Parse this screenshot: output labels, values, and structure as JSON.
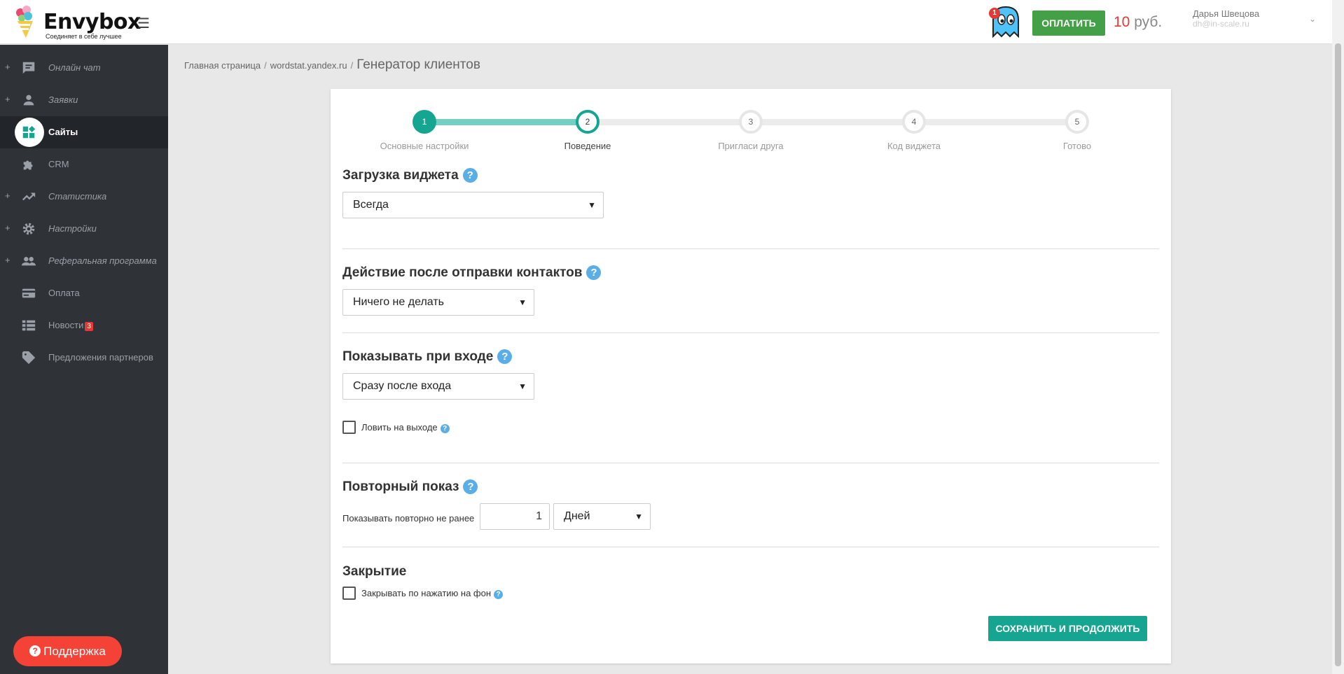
{
  "header": {
    "logo_text": "Envybox",
    "logo_tagline": "Соединяет в себе лучшее",
    "notification_count": "1",
    "pay_label": "ОПЛАТИТЬ",
    "balance_amount": "10",
    "balance_currency": " руб.",
    "user_name": "Дарья Швецова",
    "user_email": "dh@in-scale.ru"
  },
  "sidebar": {
    "items": [
      {
        "label": "Онлайн чат",
        "icon": "chat-icon"
      },
      {
        "label": "Заявки",
        "icon": "person-icon"
      },
      {
        "label": "Сайты",
        "icon": "widgets-icon"
      },
      {
        "label": "CRM",
        "icon": "puzzle-icon"
      },
      {
        "label": "Статистика",
        "icon": "trending-icon"
      },
      {
        "label": "Настройки",
        "icon": "gear-icon"
      },
      {
        "label": "Реферальная программа",
        "icon": "people-icon"
      },
      {
        "label": "Оплата",
        "icon": "card-icon"
      },
      {
        "label": "Новости",
        "icon": "list-icon",
        "badge": "3"
      },
      {
        "label": "Предложения партнеров",
        "icon": "tag-icon"
      }
    ],
    "support_label": "Поддержка"
  },
  "breadcrumb": {
    "home": "Главная страница",
    "site": "wordstat.yandex.ru",
    "current": "Генератор клиентов"
  },
  "stepper": {
    "steps": [
      {
        "num": "1",
        "label": "Основные настройки"
      },
      {
        "num": "2",
        "label": "Поведение"
      },
      {
        "num": "3",
        "label": "Пригласи друга"
      },
      {
        "num": "4",
        "label": "Код виджета"
      },
      {
        "num": "5",
        "label": "Готово"
      }
    ],
    "current_step": 2
  },
  "sections": {
    "load": {
      "title": "Загрузка виджета",
      "value": "Всегда"
    },
    "after_submit": {
      "title": "Действие после отправки контактов",
      "value": "Ничего не делать"
    },
    "show_on_enter": {
      "title": "Показывать при входе",
      "value": "Сразу после входа",
      "exit_label": "Ловить на выходе"
    },
    "repeat": {
      "title": "Повторный показ",
      "label": "Показывать повторно не ранее",
      "number": "1",
      "unit": "Дней"
    },
    "close": {
      "title": "Закрытие",
      "checkbox_label": "Закрывать по нажатию на фон"
    }
  },
  "save_label": "СОХРАНИТЬ И ПРОДОЛЖИТЬ",
  "colors": {
    "accent": "#16a591",
    "pay": "#43a047",
    "danger": "#f44336",
    "help": "#5aaee8"
  }
}
